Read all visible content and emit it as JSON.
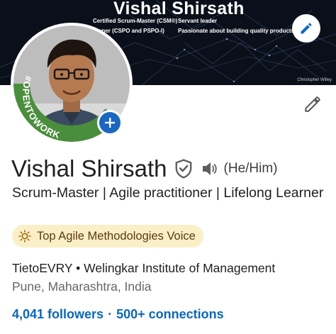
{
  "banner": {
    "name": "Vishal Shirsath",
    "lines_left": [
      "Certified Scrum-Master (CSM®)",
      "Owner (CSPO and PSPO-I)"
    ],
    "lines_right": [
      "Servant leader",
      "Passionate about building quality products."
    ],
    "credit": "Christopher Willey"
  },
  "avatar": {
    "badge_text": "#OPENTOWORK",
    "ring_color": "#4a8e3c"
  },
  "profile": {
    "name": "Vishal Shirsath",
    "pronouns": "(He/Him)",
    "headline": "Scrum-Master | Agile practitioner | Lifelong Learner",
    "voice_badge": "Top Agile Methodologies Voice",
    "companies": "TietoEVRY • Welingkar Institute of Management",
    "location": "Pune, Maharashtra, India",
    "followers": "4,041 followers",
    "separator": "·",
    "connections": "500+ connections"
  },
  "icons": {
    "edit_banner": "pencil-icon",
    "edit_profile": "pencil-icon",
    "add": "plus-icon",
    "verified": "shield-check-icon",
    "pronunciation": "speaker-icon",
    "voice": "lightbulb-icon"
  },
  "colors": {
    "brand_blue": "#0a66c2",
    "banner_bg": "#0a0f1a",
    "voice_badge_bg": "#fbefc7"
  }
}
